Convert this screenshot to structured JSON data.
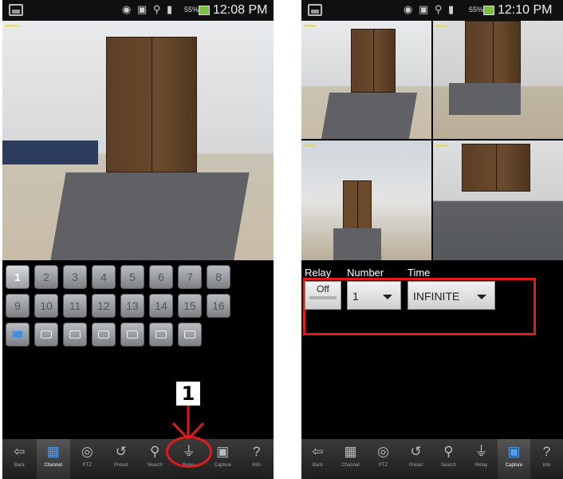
{
  "left_phone": {
    "status_time": "12:08 PM",
    "battery_pct": "55%",
    "keypad_numbers": [
      "1",
      "2",
      "3",
      "4",
      "5",
      "6",
      "7",
      "8",
      "9",
      "10",
      "11",
      "12",
      "13",
      "14",
      "15",
      "16"
    ],
    "selected_channel": "1",
    "callout_number": "1",
    "nav": [
      {
        "label": "Back",
        "icon": "back-icon"
      },
      {
        "label": "Channel",
        "icon": "grid-icon"
      },
      {
        "label": "PTZ",
        "icon": "ptz-icon"
      },
      {
        "label": "Preset",
        "icon": "preset-icon"
      },
      {
        "label": "Search",
        "icon": "search-icon"
      },
      {
        "label": "Relay",
        "icon": "relay-icon"
      },
      {
        "label": "Capture",
        "icon": "capture-icon"
      },
      {
        "label": "Info",
        "icon": "info-icon"
      }
    ],
    "selected_nav": "Channel"
  },
  "right_phone": {
    "status_time": "12:10 PM",
    "battery_pct": "55%",
    "relay_header": "Relay",
    "number_header": "Number",
    "time_header": "Time",
    "relay_button": "Off",
    "number_value": "1",
    "time_value": "INFINITE",
    "nav": [
      {
        "label": "Back",
        "icon": "back-icon"
      },
      {
        "label": "Channel",
        "icon": "grid-icon"
      },
      {
        "label": "PTZ",
        "icon": "ptz-icon"
      },
      {
        "label": "Preset",
        "icon": "preset-icon"
      },
      {
        "label": "Search",
        "icon": "search-icon"
      },
      {
        "label": "Relay",
        "icon": "relay-icon"
      },
      {
        "label": "Capture",
        "icon": "capture-icon"
      },
      {
        "label": "Info",
        "icon": "info-icon"
      }
    ],
    "selected_nav": "Capture"
  },
  "colors": {
    "highlight": "#e01b1b",
    "nav_selected_icon": "#4f9ef0"
  }
}
